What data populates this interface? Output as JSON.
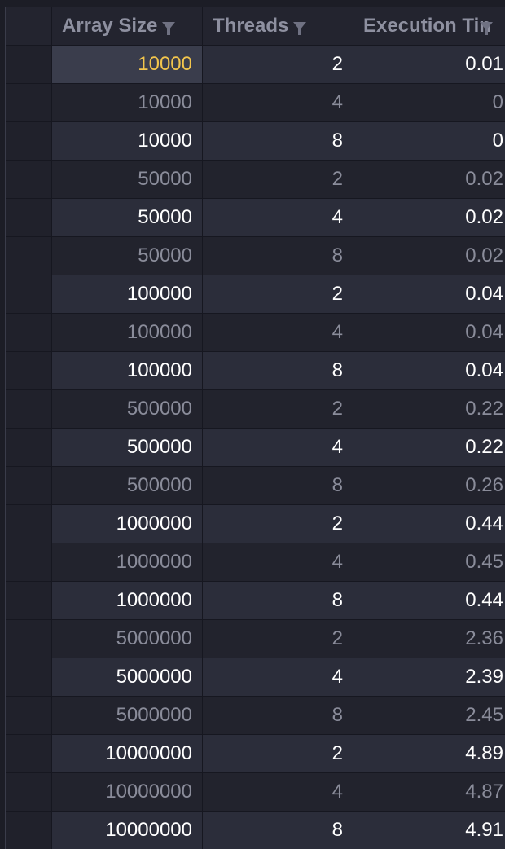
{
  "headers": [
    "Array Size",
    "Threads",
    "Execution Tin"
  ],
  "rows": [
    {
      "array_size": "10000",
      "threads": "2",
      "execution_time": "0.01"
    },
    {
      "array_size": "10000",
      "threads": "4",
      "execution_time": "0"
    },
    {
      "array_size": "10000",
      "threads": "8",
      "execution_time": "0"
    },
    {
      "array_size": "50000",
      "threads": "2",
      "execution_time": "0.02"
    },
    {
      "array_size": "50000",
      "threads": "4",
      "execution_time": "0.02"
    },
    {
      "array_size": "50000",
      "threads": "8",
      "execution_time": "0.02"
    },
    {
      "array_size": "100000",
      "threads": "2",
      "execution_time": "0.04"
    },
    {
      "array_size": "100000",
      "threads": "4",
      "execution_time": "0.04"
    },
    {
      "array_size": "100000",
      "threads": "8",
      "execution_time": "0.04"
    },
    {
      "array_size": "500000",
      "threads": "2",
      "execution_time": "0.22"
    },
    {
      "array_size": "500000",
      "threads": "4",
      "execution_time": "0.22"
    },
    {
      "array_size": "500000",
      "threads": "8",
      "execution_time": "0.26"
    },
    {
      "array_size": "1000000",
      "threads": "2",
      "execution_time": "0.44"
    },
    {
      "array_size": "1000000",
      "threads": "4",
      "execution_time": "0.45"
    },
    {
      "array_size": "1000000",
      "threads": "8",
      "execution_time": "0.44"
    },
    {
      "array_size": "5000000",
      "threads": "2",
      "execution_time": "2.36"
    },
    {
      "array_size": "5000000",
      "threads": "4",
      "execution_time": "2.39"
    },
    {
      "array_size": "5000000",
      "threads": "8",
      "execution_time": "2.45"
    },
    {
      "array_size": "10000000",
      "threads": "2",
      "execution_time": "4.89"
    },
    {
      "array_size": "10000000",
      "threads": "4",
      "execution_time": "4.87"
    },
    {
      "array_size": "10000000",
      "threads": "8",
      "execution_time": "4.91"
    }
  ],
  "colors": {
    "selected_text": "#f2c54c",
    "header_text": "#8e90a0",
    "bright_text": "#ffffff",
    "dim_text": "#8a8c9a"
  },
  "icons": {
    "filter": "filter-funnel-icon"
  }
}
